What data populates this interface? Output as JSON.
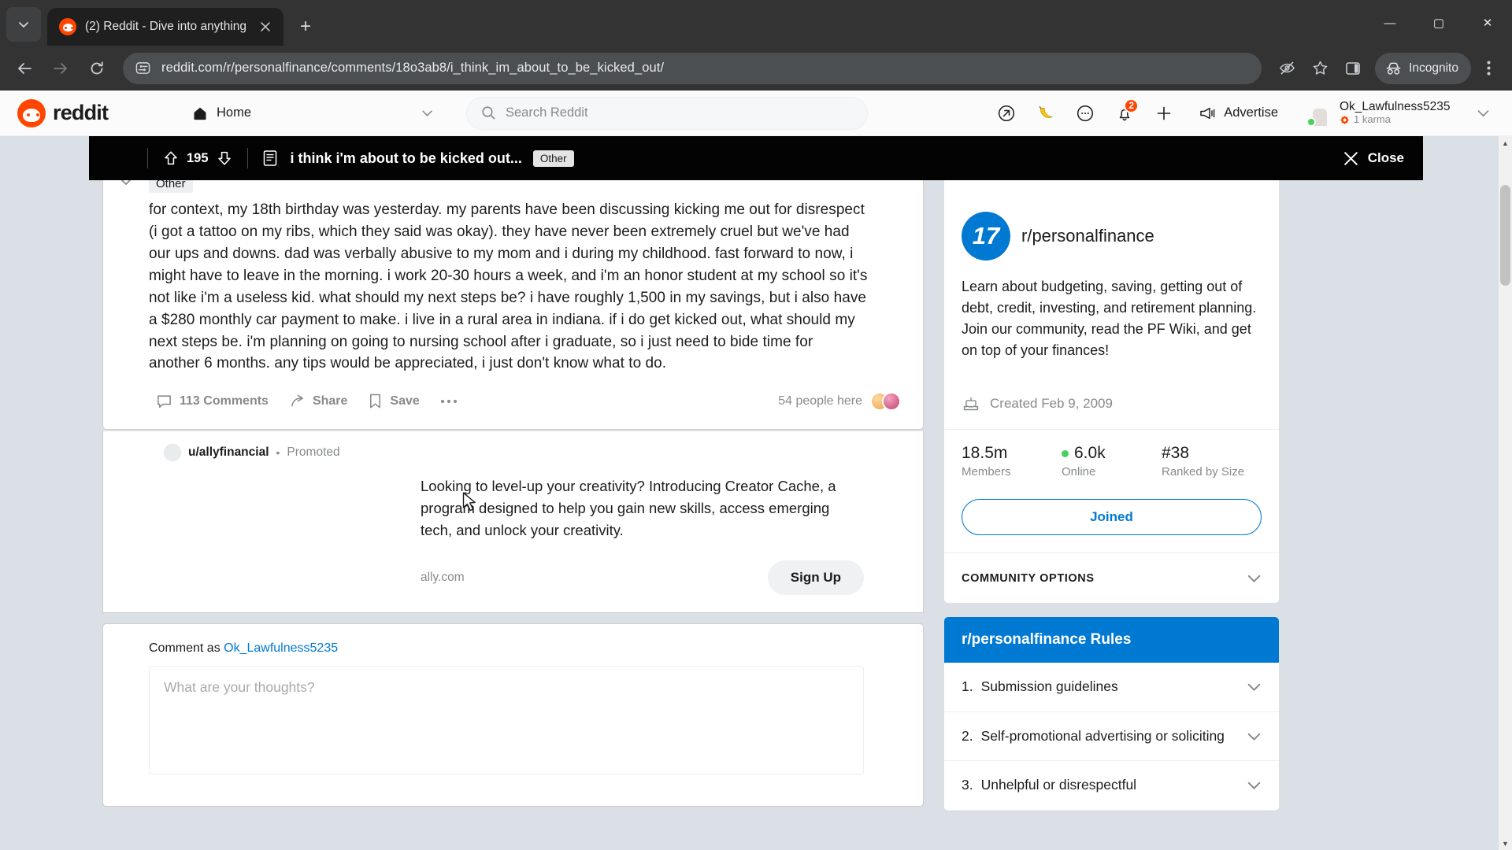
{
  "browser": {
    "tab": {
      "title": "(2) Reddit - Dive into anything",
      "favicon": "reddit-favicon"
    },
    "new_tab_label": "+",
    "window_controls": {
      "minimize": "—",
      "maximize": "▢",
      "close": "✕"
    },
    "url": "reddit.com/r/personalfinance/comments/18o3ab8/i_think_im_about_to_be_kicked_out/",
    "profile_label": "Incognito"
  },
  "reddit_header": {
    "logo_text": "reddit",
    "home_label": "Home",
    "search_placeholder": "Search Reddit",
    "notifications_count": "2",
    "advertise_label": "Advertise",
    "user": {
      "name": "Ok_Lawfulness5235",
      "karma": "1 karma"
    }
  },
  "overlay_bar": {
    "score": "195",
    "title": "i think i'm about to be kicked out...",
    "flair": "Other",
    "close_label": "Close"
  },
  "post": {
    "flair": "Other",
    "body": "for context, my 18th birthday was yesterday. my parents have been discussing kicking me out for disrespect (i got a tattoo on my ribs, which they said was okay). they have never been extremely cruel but we've had our ups and downs. dad was verbally abusive to my mom and i during my childhood. fast forward to now, i might have to leave in the morning. i work 20-30 hours a week, and i'm an honor student at my school so it's not like i'm a useless kid. what should my next steps be? i have roughly 1,500 in my savings, but i also have a $280 monthly car payment to make. i live in a rural area in indiana. if i do get kicked out, what should my next steps be. i'm planning on going to nursing school after i graduate, so i just need to bide time for another 6 months. any tips would be appreciated, i just don't know what to do.",
    "actions": {
      "comments": "113 Comments",
      "share": "Share",
      "save": "Save",
      "more": "•••",
      "people_here": "54 people here"
    }
  },
  "ad": {
    "user": "u/allyfinancial",
    "separator": "•",
    "promoted": "Promoted",
    "body": "Looking to level-up your creativity? Introducing Creator Cache, a program designed to help you gain new skills, access emerging tech, and unlock your creativity.",
    "url": "ally.com",
    "cta": "Sign Up"
  },
  "comment_composer": {
    "label_prefix": "Comment as ",
    "username": "Ok_Lawfulness5235",
    "placeholder": "What are your thoughts?"
  },
  "sidebar": {
    "subreddit": "r/personalfinance",
    "icon_glyph": "17",
    "description": "Learn about budgeting, saving, getting out of debt, credit, investing, and retirement planning. Join our community, read the PF Wiki, and get on top of your finances!",
    "created": "Created Feb 9, 2009",
    "stats": [
      {
        "value": "18.5m",
        "label": "Members",
        "dot": false
      },
      {
        "value": "6.0k",
        "label": "Online",
        "dot": true
      },
      {
        "value": "#38",
        "label": "Ranked by Size",
        "dot": false
      }
    ],
    "join_button": "Joined",
    "community_options": "COMMUNITY OPTIONS",
    "rules_title": "r/personalfinance Rules",
    "rules": [
      {
        "num": "1.",
        "text": "Submission guidelines"
      },
      {
        "num": "2.",
        "text": "Self-promotional advertising or soliciting"
      },
      {
        "num": "3.",
        "text": "Unhelpful or disrespectful"
      }
    ]
  },
  "colors": {
    "reddit_orange": "#ff4500",
    "link_blue": "#0079d3",
    "online_green": "#46d160",
    "page_bg": "#dae0e6"
  }
}
